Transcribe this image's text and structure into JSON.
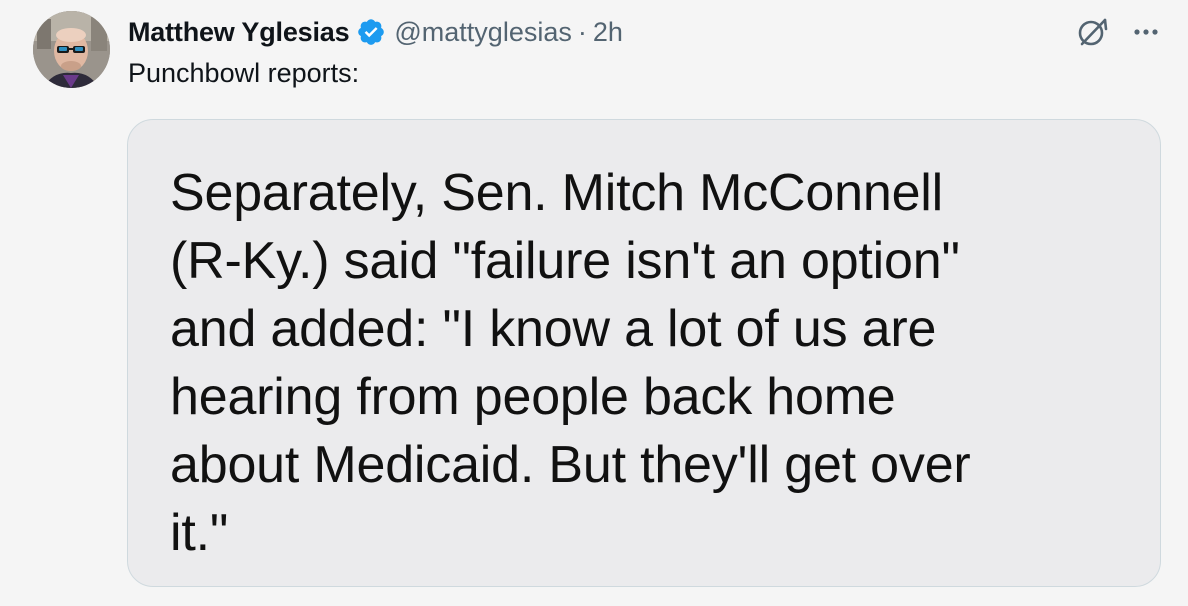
{
  "author": {
    "display_name": "Matthew Yglesias",
    "handle": "@mattyglesias",
    "separator": "·",
    "timestamp": "2h",
    "verified": true,
    "avatar_icon": "profile-photo"
  },
  "tweet": {
    "text": "Punchbowl reports:"
  },
  "media": {
    "lines": [
      "Separately, Sen. Mitch McConnell",
      "(R-Ky.) said \"failure isn't an option\"",
      "and added: \"I know a lot of us are",
      "hearing from people back home",
      "about Medicaid. But they'll get over",
      "it.\""
    ]
  },
  "icons": {
    "verified": "verified-badge-icon",
    "grok": "grok-icon",
    "more": "more-options-icon"
  },
  "colors": {
    "verified_blue": "#1d9bf0",
    "text_primary": "#0f1419",
    "text_secondary": "#536471",
    "background": "#f5f5f5",
    "media_background": "#ebebed"
  }
}
